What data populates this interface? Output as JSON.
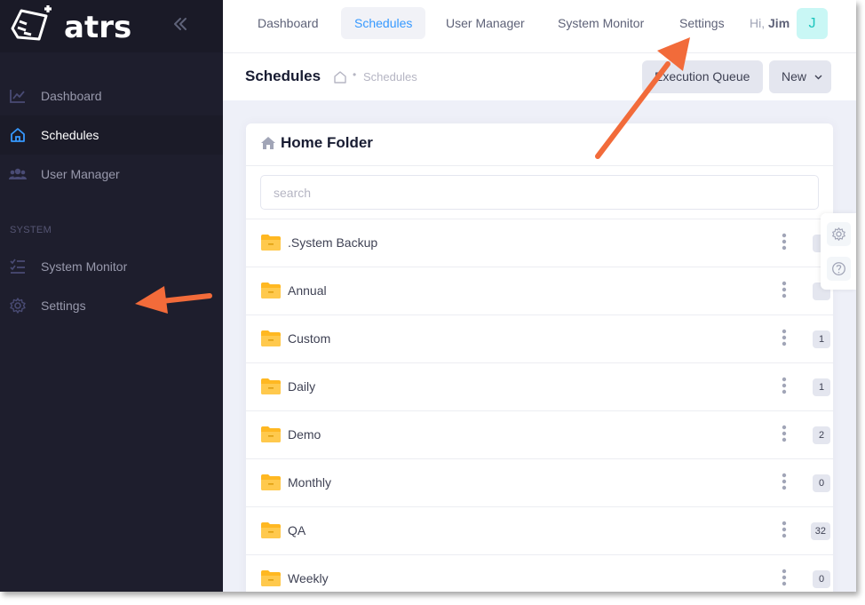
{
  "brand": {
    "logo_text": "atrs"
  },
  "sidebar": {
    "items": [
      {
        "label": "Dashboard",
        "icon": "chart-line-icon"
      },
      {
        "label": "Schedules",
        "icon": "home-icon",
        "active": true
      },
      {
        "label": "User Manager",
        "icon": "users-icon"
      }
    ],
    "section_label": "SYSTEM",
    "system_items": [
      {
        "label": "System Monitor",
        "icon": "list-check-icon"
      },
      {
        "label": "Settings",
        "icon": "gear-icon"
      }
    ]
  },
  "topbar": {
    "tabs": [
      {
        "label": "Dashboard"
      },
      {
        "label": "Schedules",
        "active": true
      },
      {
        "label": "User Manager"
      },
      {
        "label": "System Monitor"
      },
      {
        "label": "Settings"
      }
    ],
    "greeting": "Hi,",
    "user_name": "Jim",
    "avatar_initial": "J"
  },
  "subheader": {
    "title": "Schedules",
    "breadcrumb": "Schedules",
    "exec_queue_label": "Execution Queue",
    "new_label": "New"
  },
  "card": {
    "title": "Home Folder",
    "search_placeholder": "search"
  },
  "folders": [
    {
      "name": ".System Backup",
      "count": ""
    },
    {
      "name": "Annual",
      "count": ""
    },
    {
      "name": "Custom",
      "count": "1"
    },
    {
      "name": "Daily",
      "count": "1"
    },
    {
      "name": "Demo",
      "count": "2"
    },
    {
      "name": "Monthly",
      "count": "0"
    },
    {
      "name": "QA",
      "count": "32"
    },
    {
      "name": "Weekly",
      "count": "0"
    }
  ],
  "colors": {
    "sidebar_bg": "#1e1e2d",
    "accent": "#3699ff",
    "folder": "#ffb822",
    "annotation_arrow": "#f26b3a"
  }
}
